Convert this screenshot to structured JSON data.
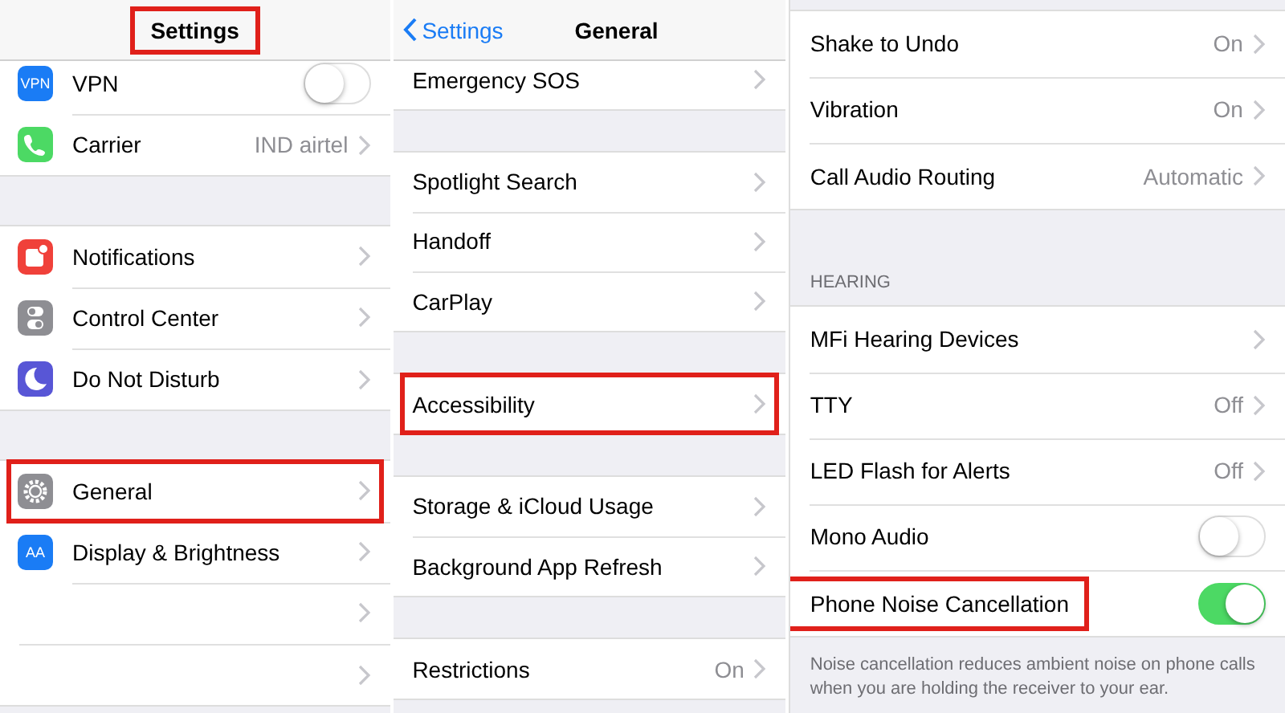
{
  "panels": [
    {
      "nav": {
        "title": "Settings",
        "highlighted": true
      },
      "groups": [
        {
          "items": [
            {
              "kind": "toggle",
              "icon_text": "VPN",
              "color": "#1a7cf5",
              "label": "VPN",
              "on": false
            },
            {
              "kind": "link",
              "color": "#4cd964",
              "label": "Carrier",
              "value": "IND airtel"
            }
          ]
        },
        {
          "items": [
            {
              "kind": "link",
              "color": "#f0413a",
              "label": "Notifications"
            },
            {
              "kind": "link",
              "color": "#8e8e93",
              "label": "Control Center"
            },
            {
              "kind": "link",
              "color": "#5856d6",
              "label": "Do Not Disturb"
            }
          ]
        },
        {
          "items": [
            {
              "kind": "link",
              "color": "#8e8e93",
              "label": "General",
              "highlighted": true
            },
            {
              "kind": "link",
              "icon_text": "AA",
              "color": "#1a7cf5",
              "label": "Display & Brightness"
            },
            {
              "kind": "link"
            },
            {
              "kind": "link"
            }
          ]
        }
      ]
    },
    {
      "nav": {
        "back": "Settings",
        "title": "General",
        "highlighted": false
      },
      "groups": [
        {
          "items": [
            {
              "kind": "link",
              "label": "Emergency SOS"
            }
          ]
        },
        {
          "items": [
            {
              "kind": "link",
              "label": "Spotlight Search"
            },
            {
              "kind": "link",
              "label": "Handoff"
            },
            {
              "kind": "link",
              "label": "CarPlay"
            }
          ]
        },
        {
          "items": [
            {
              "kind": "link",
              "label": "Accessibility",
              "highlighted": true
            }
          ]
        },
        {
          "items": [
            {
              "kind": "link",
              "label": "Storage & iCloud Usage"
            },
            {
              "kind": "link",
              "label": "Background App Refresh"
            }
          ]
        },
        {
          "items": [
            {
              "kind": "link",
              "label": "Restrictions",
              "value": "On"
            }
          ]
        }
      ]
    },
    {
      "groups": [
        {
          "items": [
            {
              "kind": "link",
              "label": "Shake to Undo",
              "value": "On"
            },
            {
              "kind": "link",
              "label": "Vibration",
              "value": "On"
            },
            {
              "kind": "link",
              "label": "Call Audio Routing",
              "value": "Automatic"
            }
          ]
        },
        {
          "header": "HEARING",
          "footer": "Noise cancellation reduces ambient noise on phone calls when you are holding the receiver to your ear.",
          "items": [
            {
              "kind": "link",
              "label": "MFi Hearing Devices"
            },
            {
              "kind": "link",
              "label": "TTY",
              "value": "Off"
            },
            {
              "kind": "link",
              "label": "LED Flash for Alerts",
              "value": "Off"
            },
            {
              "kind": "toggle",
              "label": "Mono Audio",
              "on": false
            },
            {
              "kind": "toggle",
              "label": "Phone Noise Cancellation",
              "on": true,
              "highlighted": true
            }
          ]
        }
      ]
    }
  ]
}
